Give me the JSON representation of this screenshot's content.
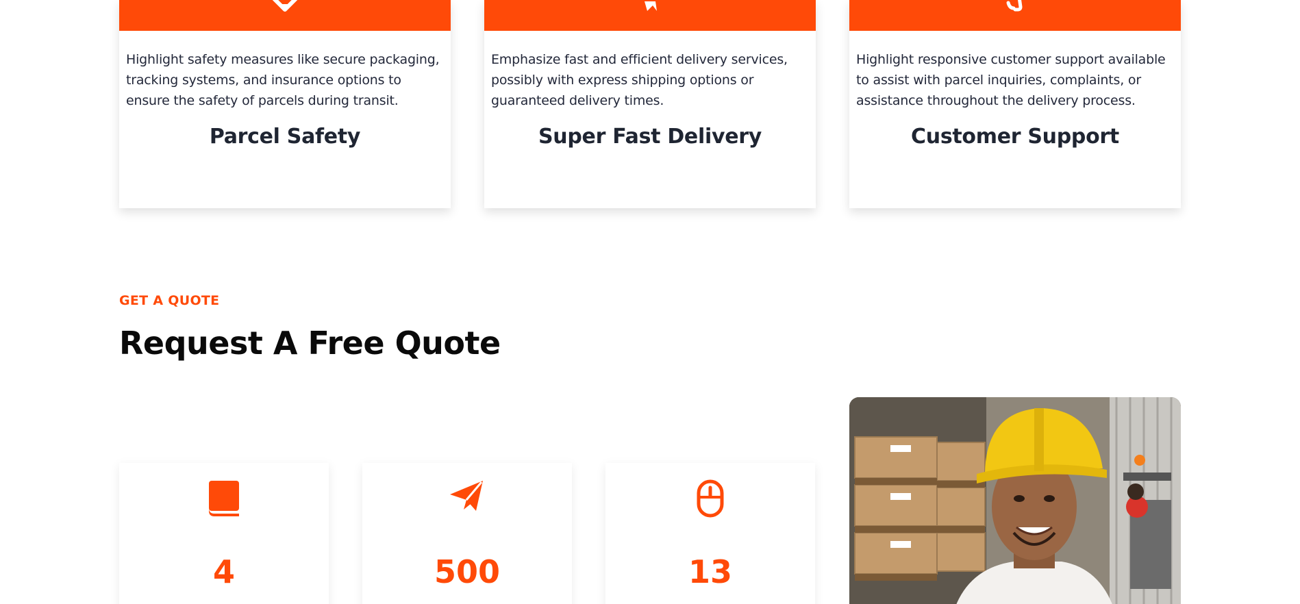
{
  "colors": {
    "accent": "#ff4a08",
    "text": "#1f2532",
    "heading": "#0a0a0a"
  },
  "features": [
    {
      "icon": "box-icon",
      "description": "Highlight safety measures like secure packaging, tracking systems, and insurance options to ensure the safety of parcels during transit.",
      "title": "Parcel Safety"
    },
    {
      "icon": "fast-delivery-icon",
      "description": "Emphasize fast and efficient delivery services, possibly with express shipping options or guaranteed delivery times.",
      "title": "Super Fast Delivery"
    },
    {
      "icon": "headset-icon",
      "description": "Highlight responsive customer support available to assist with parcel inquiries, complaints, or assistance throughout the delivery process.",
      "title": "Customer Support"
    }
  ],
  "quote": {
    "eyebrow": "GET A QUOTE",
    "title": "Request A Free Quote"
  },
  "stats": [
    {
      "icon": "book-icon",
      "value": "4"
    },
    {
      "icon": "paper-plane-icon",
      "value": "500"
    },
    {
      "icon": "mouse-icon",
      "value": "13"
    }
  ]
}
